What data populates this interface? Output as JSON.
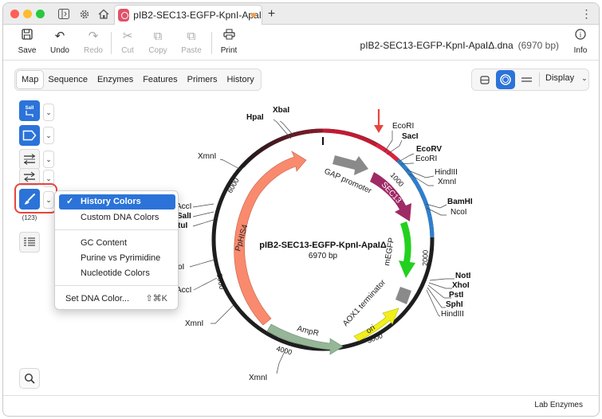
{
  "title_bar": {
    "doc_tab_title": "pIB2-SEC13-EGFP-KpnI-ApaI",
    "new_tab_symbol": "+",
    "more_symbol": "⋮"
  },
  "toolbar": {
    "save": "Save",
    "undo": "Undo",
    "redo": "Redo",
    "cut": "Cut",
    "copy": "Copy",
    "paste": "Paste",
    "print": "Print",
    "info": "Info",
    "file_name": "pIB2-SEC13-EGFP-KpnI-ApaIΔ.dna",
    "file_size": "(6970 bp)"
  },
  "view_tabs": [
    "Map",
    "Sequence",
    "Enzymes",
    "Features",
    "Primers",
    "History"
  ],
  "view_control": {
    "display_label": "Display"
  },
  "left_tools": {
    "enzyme_btn_label": "SalI",
    "counter": "(123)"
  },
  "color_menu": {
    "items": [
      {
        "label": "History Colors",
        "selected": true
      },
      {
        "label": "Custom DNA Colors"
      },
      {
        "label": "GC Content"
      },
      {
        "label": "Purine vs Pyrimidine"
      },
      {
        "label": "Nucleotide Colors"
      },
      {
        "label": "Set DNA Color...",
        "shortcut": "⇧⌘K"
      }
    ]
  },
  "map": {
    "name": "pIB2-SEC13-EGFP-KpnI-ApaIΔ",
    "length": "6970 bp",
    "ticks": [
      "1000",
      "2000",
      "3000",
      "4000",
      "5000",
      "6000"
    ],
    "features": [
      "GAP promoter",
      "SEC13",
      "mEGFP",
      "AOX1 terminator",
      "ori",
      "AmpR",
      "PpHIS4"
    ],
    "enzymes_right": [
      "EcoRI",
      "SacI",
      "EcoRV",
      "EcoRI",
      "HindIII",
      "XmnI",
      "BamHI",
      "NcoI",
      "NotI",
      "XhoI",
      "PstI",
      "SphI",
      "HindIII"
    ],
    "enzymes_left_top": [
      "XbaI",
      "HpaI",
      "XmnI"
    ],
    "enzymes_left_partial": [
      "AccI",
      "SalI",
      "tuI",
      "oI",
      "AccI"
    ],
    "enzymes_bottom": [
      "XmnI",
      "XmnI"
    ],
    "colors": {
      "history_red": "#e0203e",
      "history_blue": "#2d7fd0",
      "arrow": "#e8453c"
    }
  },
  "status_bar": {
    "right_label": "Lab Enzymes"
  }
}
